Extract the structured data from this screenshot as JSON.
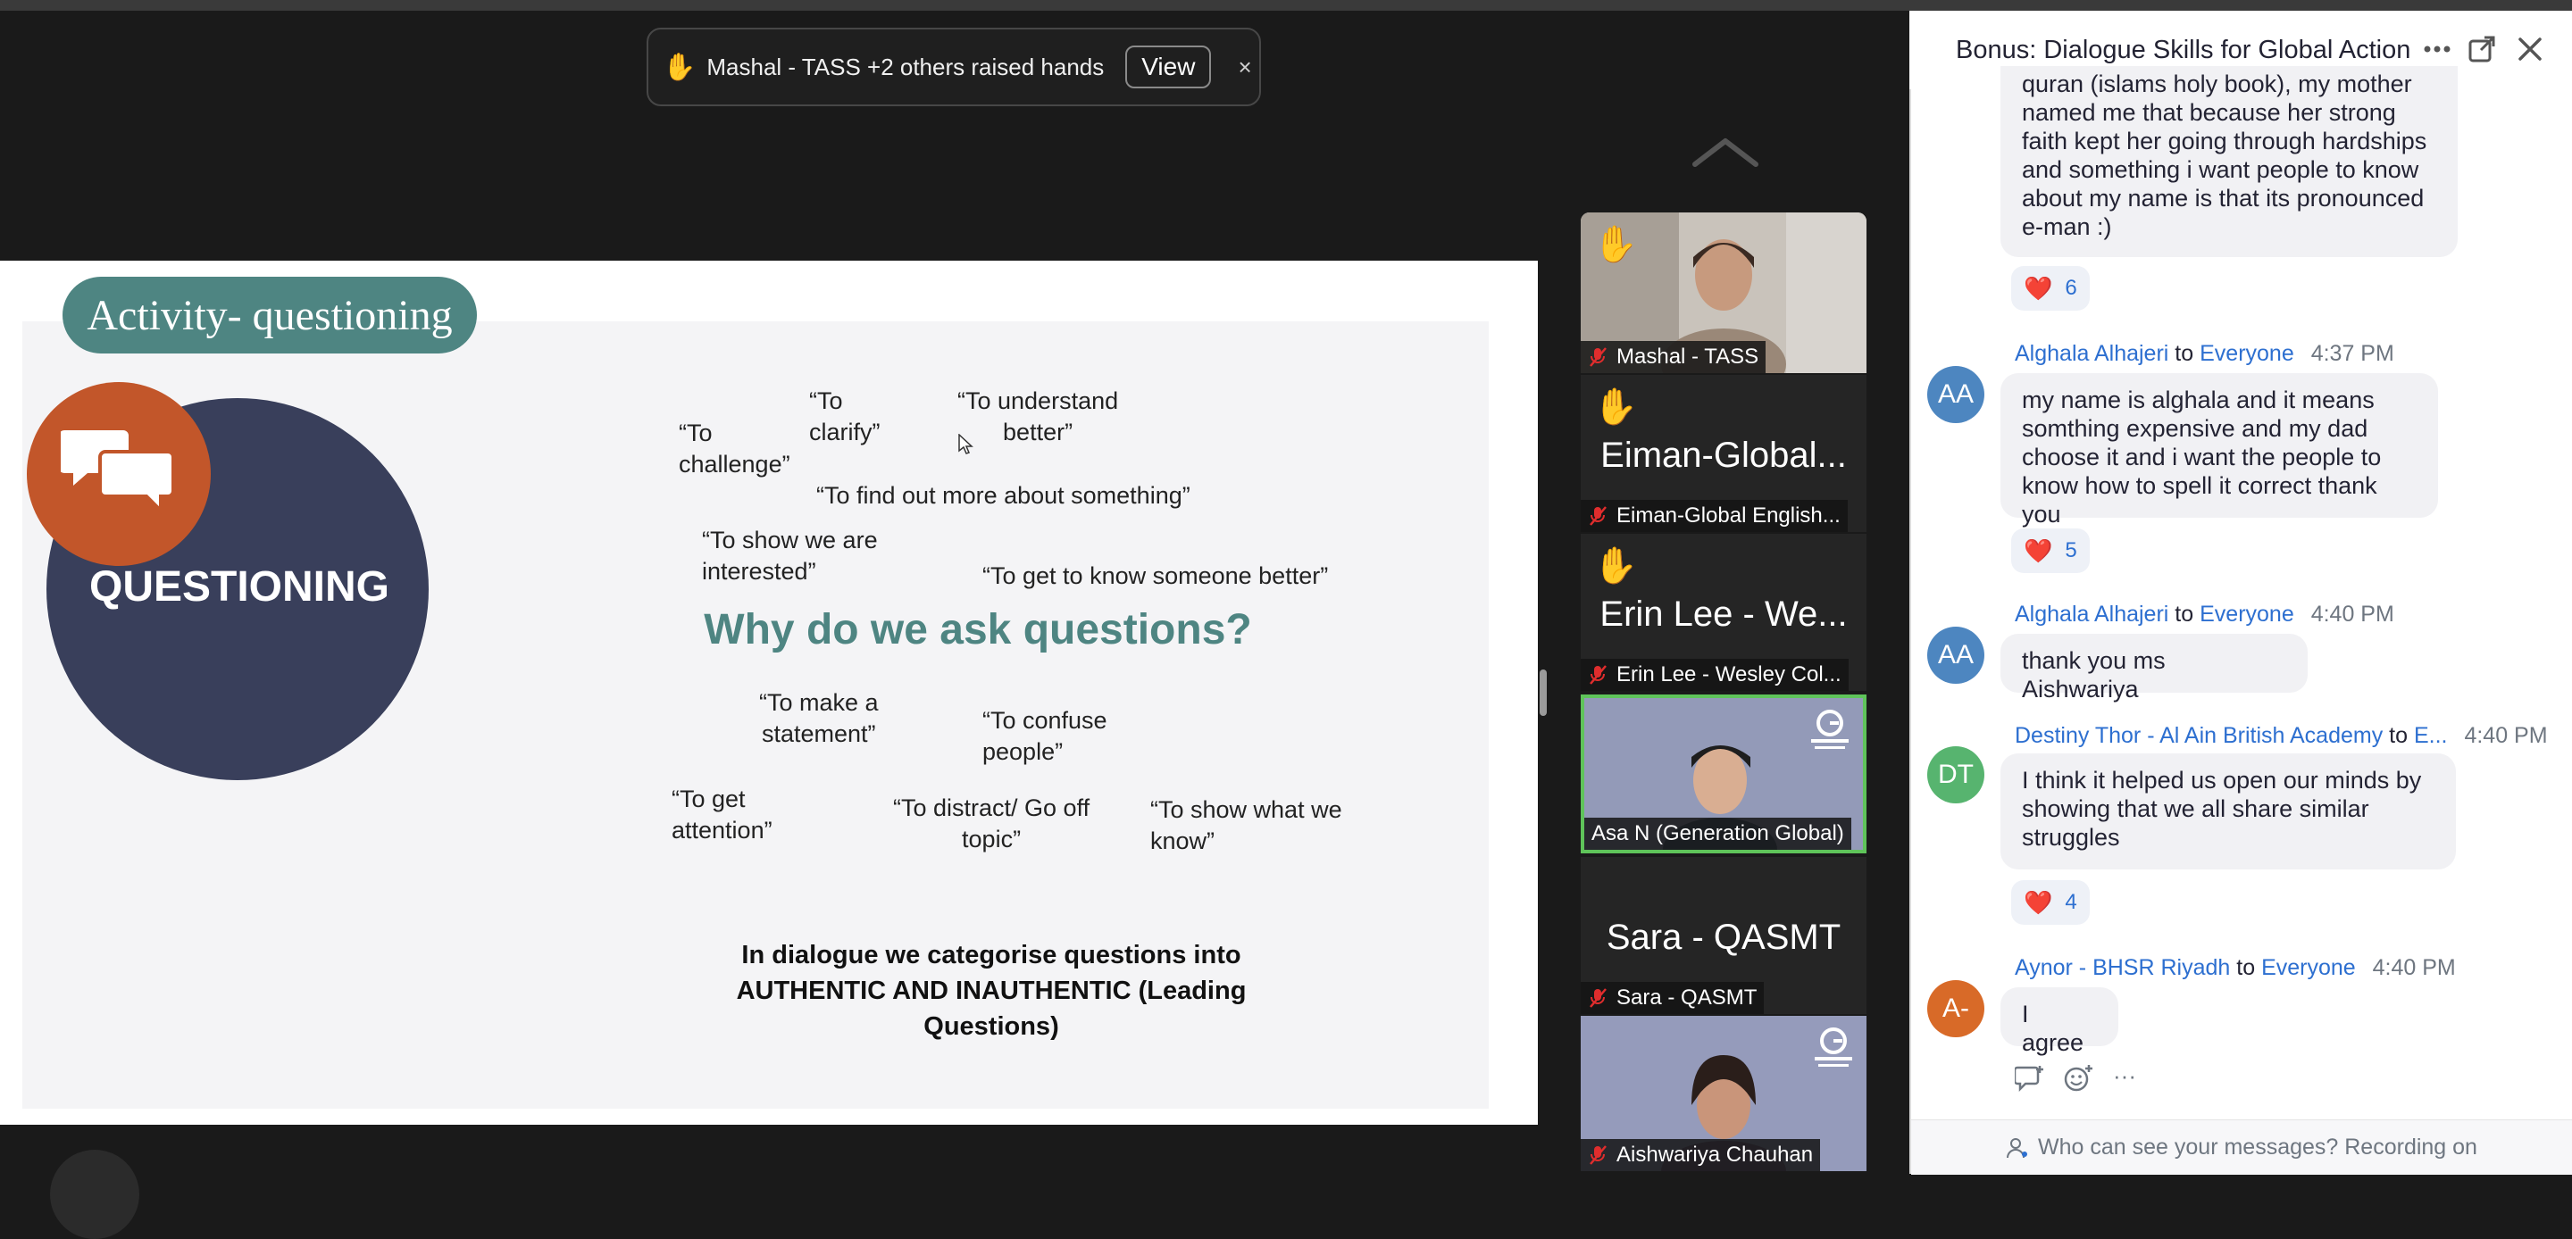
{
  "notification": {
    "hand": "✋",
    "text": "Mashal - TASS +2 others raised hands",
    "view_label": "View",
    "close": "×"
  },
  "slide": {
    "activity_title": "Activity- questioning",
    "circle_label": "QUESTIONING",
    "heading": "Why do we ask questions?",
    "quotes": {
      "challenge": "“To\nchallenge”",
      "clarify": "“To\nclarify”",
      "understand": "“To understand\nbetter”",
      "find_out": "“To find out more about something”",
      "interested": "“To show we are\ninterested”",
      "know_someone": "“To get to know someone better”",
      "statement": "“To make a\nstatement”",
      "confuse": "“To confuse\npeople”",
      "attention": "“To get\nattention”",
      "distract": "“To distract/ Go off\ntopic”",
      "show_know": "“To show what we\nknow”"
    },
    "bottom_text": "In dialogue we categorise questions into AUTHENTIC AND INAUTHENTIC (Leading Questions)"
  },
  "participants": [
    {
      "name": "Mashal - TASS",
      "hand": "✋",
      "display": ""
    },
    {
      "name": "Eiman-Global English...",
      "hand": "✋",
      "display": "Eiman-Global..."
    },
    {
      "name": "Erin Lee - Wesley Col...",
      "hand": "✋",
      "display": "Erin Lee - We..."
    },
    {
      "name": "Asa N (Generation Global)",
      "hand": "",
      "display": ""
    },
    {
      "name": "Sara - QASMT",
      "hand": "",
      "display": "Sara - QASMT"
    },
    {
      "name": "Aishwariya Chauhan",
      "hand": "",
      "display": ""
    }
  ],
  "chat": {
    "title": "Bonus: Dialogue Skills for Global Action...",
    "messages": [
      {
        "avatar": "",
        "sender": "",
        "to": "",
        "recipient": "",
        "time": "",
        "text": "quran (islams holy book), my mother named me that because her strong faith kept her going through hardships and something i want people to know about my name is that its pronounced e-man :)",
        "reaction": "6"
      },
      {
        "avatar": "AA",
        "sender": "Alghala Alhajeri",
        "to": "to",
        "recipient": "Everyone",
        "time": "4:37 PM",
        "text": "my name is alghala and it means somthing expensive and my dad choose it  and i want the people to know how to spell it correct thank you",
        "reaction": "5"
      },
      {
        "avatar": "AA",
        "sender": "Alghala Alhajeri",
        "to": "to",
        "recipient": "Everyone",
        "time": "4:40 PM",
        "text": "thank you ms Aishwariya",
        "reaction": ""
      },
      {
        "avatar": "DT",
        "sender": "Destiny Thor - Al Ain British Academy",
        "to": "to",
        "recipient": "E...",
        "time": "4:40 PM",
        "text": "I think it helped us open our minds by showing that we all share similar struggles",
        "reaction": "4"
      },
      {
        "avatar": "A-",
        "sender": "Aynor - BHSR Riyadh",
        "to": "to",
        "recipient": "Everyone",
        "time": "4:40 PM",
        "text": "I agree",
        "reaction": ""
      }
    ],
    "heart": "❤️",
    "more_dots": "···",
    "footer": "Who can see your messages? Recording on"
  },
  "colors": {
    "accent_teal": "#4e8582",
    "circle_navy": "#393f5b",
    "circle_orange": "#c2562a",
    "link_blue": "#2d6fd0",
    "avatar_aa": "#4d86c0",
    "avatar_dt": "#57b46f",
    "avatar_a": "#d86a28",
    "active_speaker": "#5fc45a"
  }
}
